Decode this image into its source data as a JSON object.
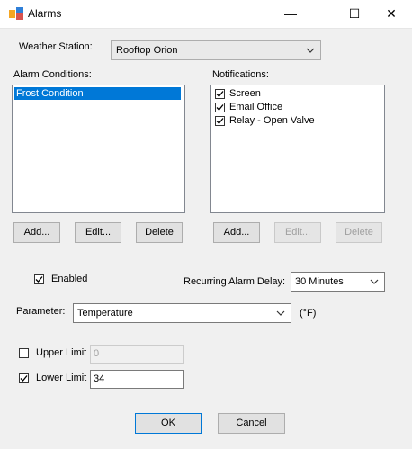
{
  "window": {
    "title": "Alarms",
    "minimize_glyph": "—",
    "maximize_glyph": "☐",
    "close_glyph": "✕"
  },
  "weather_station": {
    "label": "Weather Station:",
    "selected": "Rooftop Orion"
  },
  "alarm_conditions": {
    "label": "Alarm Conditions:",
    "items": [
      "Frost Condition"
    ],
    "buttons": {
      "add": "Add...",
      "edit": "Edit...",
      "delete": "Delete"
    }
  },
  "notifications": {
    "label": "Notifications:",
    "items": [
      {
        "label": "Screen",
        "checked": true
      },
      {
        "label": "Email Office",
        "checked": true
      },
      {
        "label": "Relay - Open Valve",
        "checked": true
      }
    ],
    "buttons": {
      "add": "Add...",
      "edit": "Edit...",
      "delete": "Delete"
    }
  },
  "enabled": {
    "label": "Enabled",
    "checked": true
  },
  "recurring_delay": {
    "label": "Recurring Alarm Delay:",
    "selected": "30 Minutes"
  },
  "parameter": {
    "label": "Parameter:",
    "selected": "Temperature",
    "unit": "(°F)"
  },
  "upper_limit": {
    "label": "Upper Limit",
    "checked": false,
    "value": "0"
  },
  "lower_limit": {
    "label": "Lower Limit",
    "checked": true,
    "value": "34"
  },
  "footer": {
    "ok": "OK",
    "cancel": "Cancel"
  },
  "colors": {
    "selection": "#0078d7",
    "dialog_bg": "#f0f0f0"
  }
}
